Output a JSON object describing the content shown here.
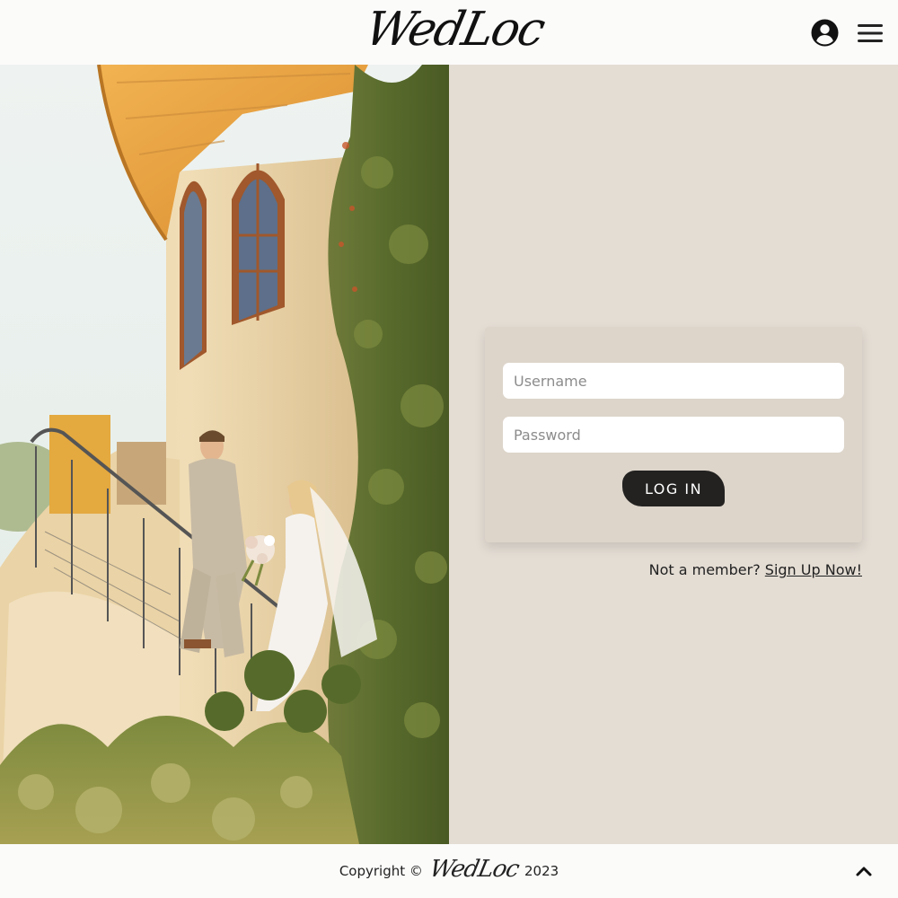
{
  "header": {
    "logo_text": "WedLoc",
    "account_icon": "user-circle-icon",
    "menu_icon": "hamburger-menu-icon"
  },
  "hero": {
    "image_description": "photo-of-bride-and-groom-descending-stairs"
  },
  "login": {
    "username_placeholder": "Username",
    "password_placeholder": "Password",
    "username_value": "",
    "password_value": "",
    "button_label": "LOG IN",
    "signup_prompt": "Not a member?",
    "signup_link": "Sign Up Now!"
  },
  "footer": {
    "copyright_text": "Copyright ©",
    "logo_text": "WedLoc",
    "year": "2023",
    "scroll_top_icon": "chevron-up-icon"
  },
  "colors": {
    "panel_bg": "#e4ddd4",
    "card_bg": "#ddd5ca",
    "button_bg": "#232221",
    "header_bg": "#fbfbfa"
  }
}
